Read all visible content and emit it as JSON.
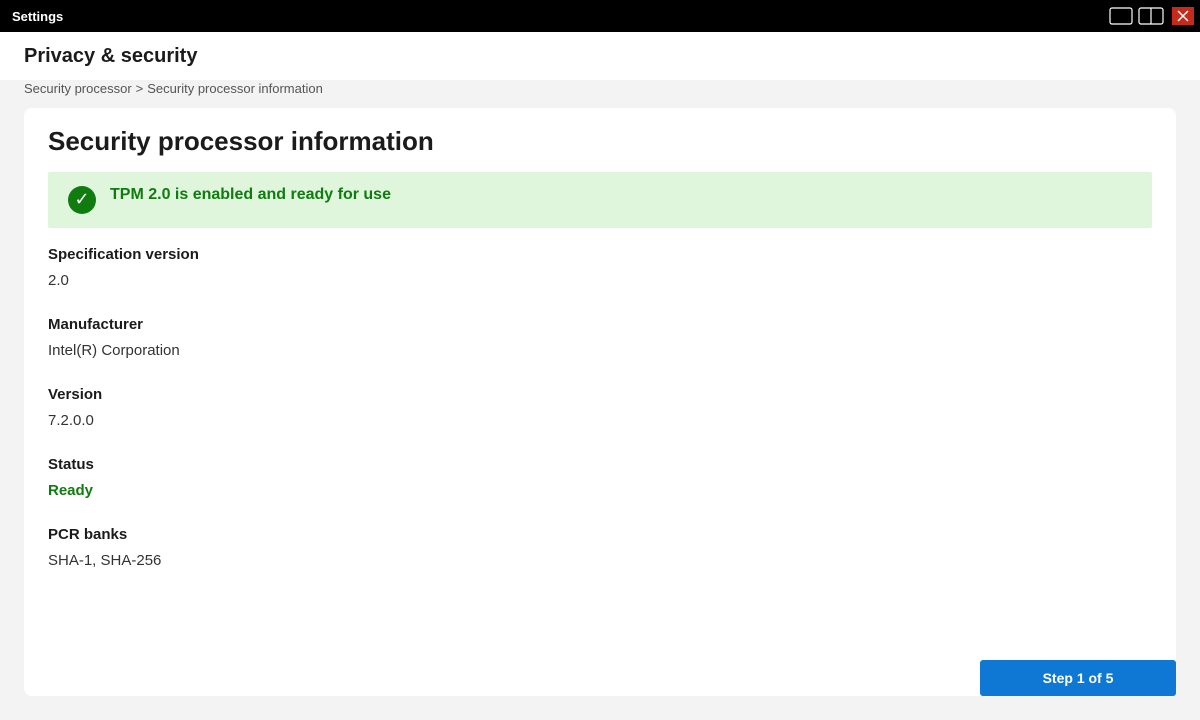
{
  "window": {
    "title": "Settings",
    "controls": [
      "restore-icon",
      "snap-layout-icon",
      "close-icon"
    ],
    "close_color": "#c42b1c"
  },
  "header": {
    "title": "Privacy & security"
  },
  "breadcrumb": {
    "items": [
      "Security processor",
      "Security processor information"
    ],
    "separator": ">"
  },
  "main": {
    "title": "Security processor information",
    "banner": {
      "icon": "checkmark-icon",
      "glyph": "✓",
      "text": "TPM 2.0 is enabled and ready for use",
      "color": "#107c10",
      "background": "#dff6dd"
    },
    "fields": [
      {
        "label": "Specification version",
        "value": "2.0"
      },
      {
        "label": "Manufacturer",
        "value": "Intel(R) Corporation"
      },
      {
        "label": "Version",
        "value": "7.2.0.0"
      },
      {
        "label": "Status",
        "value": "Ready"
      },
      {
        "label": "PCR banks",
        "value": "SHA-1, SHA-256"
      }
    ]
  },
  "footer": {
    "step_label": "Step 1 of 5",
    "accent": "#0f78d4"
  }
}
